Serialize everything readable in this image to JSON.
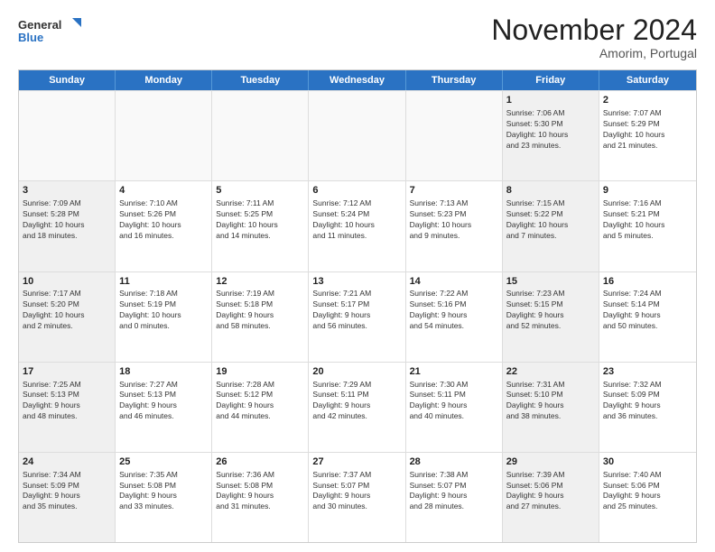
{
  "logo": {
    "line1": "General",
    "line2": "Blue"
  },
  "title": "November 2024",
  "location": "Amorim, Portugal",
  "weekdays": [
    "Sunday",
    "Monday",
    "Tuesday",
    "Wednesday",
    "Thursday",
    "Friday",
    "Saturday"
  ],
  "rows": [
    [
      {
        "day": "",
        "text": "",
        "empty": true
      },
      {
        "day": "",
        "text": "",
        "empty": true
      },
      {
        "day": "",
        "text": "",
        "empty": true
      },
      {
        "day": "",
        "text": "",
        "empty": true
      },
      {
        "day": "",
        "text": "",
        "empty": true
      },
      {
        "day": "1",
        "text": "Sunrise: 7:06 AM\nSunset: 5:30 PM\nDaylight: 10 hours\nand 23 minutes.",
        "shaded": true
      },
      {
        "day": "2",
        "text": "Sunrise: 7:07 AM\nSunset: 5:29 PM\nDaylight: 10 hours\nand 21 minutes.",
        "shaded": false
      }
    ],
    [
      {
        "day": "3",
        "text": "Sunrise: 7:09 AM\nSunset: 5:28 PM\nDaylight: 10 hours\nand 18 minutes.",
        "shaded": true
      },
      {
        "day": "4",
        "text": "Sunrise: 7:10 AM\nSunset: 5:26 PM\nDaylight: 10 hours\nand 16 minutes.",
        "shaded": false
      },
      {
        "day": "5",
        "text": "Sunrise: 7:11 AM\nSunset: 5:25 PM\nDaylight: 10 hours\nand 14 minutes.",
        "shaded": false
      },
      {
        "day": "6",
        "text": "Sunrise: 7:12 AM\nSunset: 5:24 PM\nDaylight: 10 hours\nand 11 minutes.",
        "shaded": false
      },
      {
        "day": "7",
        "text": "Sunrise: 7:13 AM\nSunset: 5:23 PM\nDaylight: 10 hours\nand 9 minutes.",
        "shaded": false
      },
      {
        "day": "8",
        "text": "Sunrise: 7:15 AM\nSunset: 5:22 PM\nDaylight: 10 hours\nand 7 minutes.",
        "shaded": true
      },
      {
        "day": "9",
        "text": "Sunrise: 7:16 AM\nSunset: 5:21 PM\nDaylight: 10 hours\nand 5 minutes.",
        "shaded": false
      }
    ],
    [
      {
        "day": "10",
        "text": "Sunrise: 7:17 AM\nSunset: 5:20 PM\nDaylight: 10 hours\nand 2 minutes.",
        "shaded": true
      },
      {
        "day": "11",
        "text": "Sunrise: 7:18 AM\nSunset: 5:19 PM\nDaylight: 10 hours\nand 0 minutes.",
        "shaded": false
      },
      {
        "day": "12",
        "text": "Sunrise: 7:19 AM\nSunset: 5:18 PM\nDaylight: 9 hours\nand 58 minutes.",
        "shaded": false
      },
      {
        "day": "13",
        "text": "Sunrise: 7:21 AM\nSunset: 5:17 PM\nDaylight: 9 hours\nand 56 minutes.",
        "shaded": false
      },
      {
        "day": "14",
        "text": "Sunrise: 7:22 AM\nSunset: 5:16 PM\nDaylight: 9 hours\nand 54 minutes.",
        "shaded": false
      },
      {
        "day": "15",
        "text": "Sunrise: 7:23 AM\nSunset: 5:15 PM\nDaylight: 9 hours\nand 52 minutes.",
        "shaded": true
      },
      {
        "day": "16",
        "text": "Sunrise: 7:24 AM\nSunset: 5:14 PM\nDaylight: 9 hours\nand 50 minutes.",
        "shaded": false
      }
    ],
    [
      {
        "day": "17",
        "text": "Sunrise: 7:25 AM\nSunset: 5:13 PM\nDaylight: 9 hours\nand 48 minutes.",
        "shaded": true
      },
      {
        "day": "18",
        "text": "Sunrise: 7:27 AM\nSunset: 5:13 PM\nDaylight: 9 hours\nand 46 minutes.",
        "shaded": false
      },
      {
        "day": "19",
        "text": "Sunrise: 7:28 AM\nSunset: 5:12 PM\nDaylight: 9 hours\nand 44 minutes.",
        "shaded": false
      },
      {
        "day": "20",
        "text": "Sunrise: 7:29 AM\nSunset: 5:11 PM\nDaylight: 9 hours\nand 42 minutes.",
        "shaded": false
      },
      {
        "day": "21",
        "text": "Sunrise: 7:30 AM\nSunset: 5:11 PM\nDaylight: 9 hours\nand 40 minutes.",
        "shaded": false
      },
      {
        "day": "22",
        "text": "Sunrise: 7:31 AM\nSunset: 5:10 PM\nDaylight: 9 hours\nand 38 minutes.",
        "shaded": true
      },
      {
        "day": "23",
        "text": "Sunrise: 7:32 AM\nSunset: 5:09 PM\nDaylight: 9 hours\nand 36 minutes.",
        "shaded": false
      }
    ],
    [
      {
        "day": "24",
        "text": "Sunrise: 7:34 AM\nSunset: 5:09 PM\nDaylight: 9 hours\nand 35 minutes.",
        "shaded": true
      },
      {
        "day": "25",
        "text": "Sunrise: 7:35 AM\nSunset: 5:08 PM\nDaylight: 9 hours\nand 33 minutes.",
        "shaded": false
      },
      {
        "day": "26",
        "text": "Sunrise: 7:36 AM\nSunset: 5:08 PM\nDaylight: 9 hours\nand 31 minutes.",
        "shaded": false
      },
      {
        "day": "27",
        "text": "Sunrise: 7:37 AM\nSunset: 5:07 PM\nDaylight: 9 hours\nand 30 minutes.",
        "shaded": false
      },
      {
        "day": "28",
        "text": "Sunrise: 7:38 AM\nSunset: 5:07 PM\nDaylight: 9 hours\nand 28 minutes.",
        "shaded": false
      },
      {
        "day": "29",
        "text": "Sunrise: 7:39 AM\nSunset: 5:06 PM\nDaylight: 9 hours\nand 27 minutes.",
        "shaded": true
      },
      {
        "day": "30",
        "text": "Sunrise: 7:40 AM\nSunset: 5:06 PM\nDaylight: 9 hours\nand 25 minutes.",
        "shaded": false
      }
    ]
  ]
}
